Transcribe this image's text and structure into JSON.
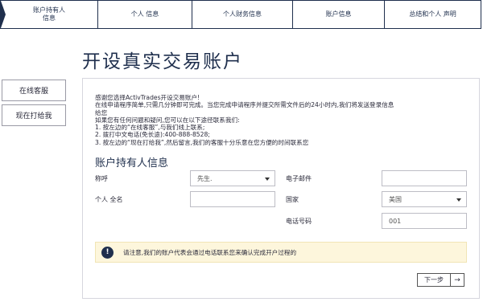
{
  "steps": [
    {
      "label": "账户持有人\n信息",
      "active": true
    },
    {
      "label": "个人 信息",
      "active": false
    },
    {
      "label": "个人财务信息",
      "active": false
    },
    {
      "label": "账户信息",
      "active": false
    },
    {
      "label": "总结和个人 声明",
      "active": false
    }
  ],
  "page_title": "开设真实交易账户",
  "side": {
    "live_support": "在线客服",
    "call_now": "现在打给我"
  },
  "intro": {
    "lines": [
      "感谢您选择ActivTrades开设交易账户!",
      "在线申请程序简单,只需几分钟即可完成。当您完成申请程序并提交所需文件后的24小时内,我们将发送登录信息",
      "给您",
      "如果您有任何问题和疑问,您可以在以下途径联系我们:",
      "1. 按左边的“在线客服”,与我们线上联系;",
      "2. 拨打中文电话(免长途):400-888-8528;",
      "3. 按左边的“现在打给我”,然后留言,我们的客服十分乐意在您方便的时间联系您"
    ]
  },
  "section_title": "账户持有人信息",
  "form": {
    "salutation_label": "称呼",
    "salutation_value": "先生.",
    "fullname_label": "个人 全名",
    "fullname_value": "",
    "email_label": "电子邮件",
    "email_value": "",
    "country_label": "国家",
    "country_value": "美国",
    "phone_label": "电话号码",
    "phone_value": "001"
  },
  "notice": {
    "icon": "!",
    "text": "请注意,我们的账户代表会通过电话联系您来确认完成开户过程的"
  },
  "next": {
    "label": "下一步",
    "arrow": "→"
  }
}
